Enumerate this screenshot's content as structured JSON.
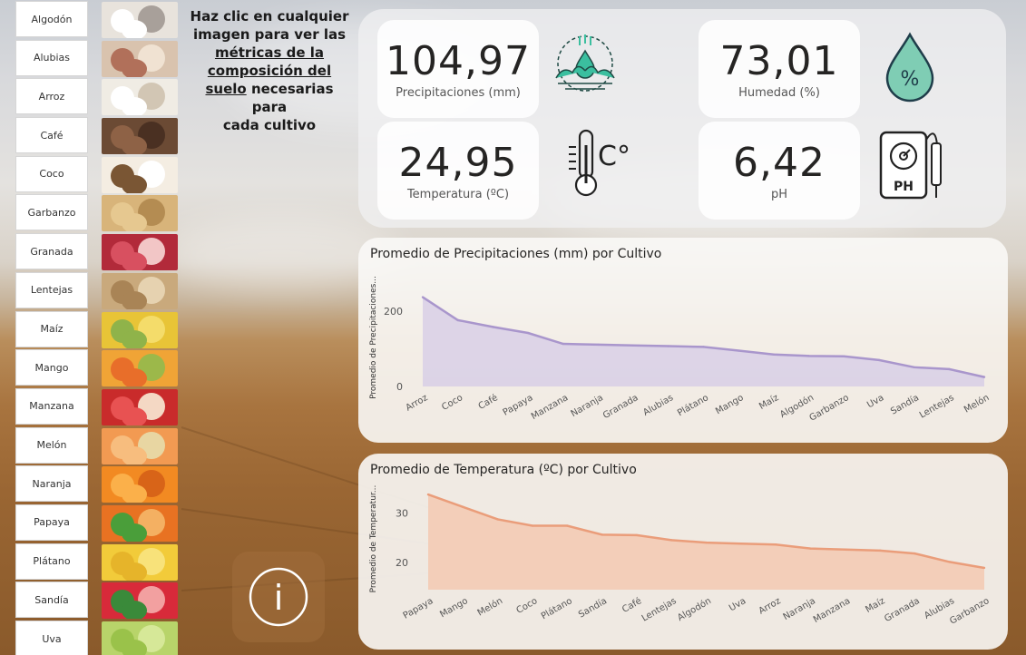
{
  "intro": {
    "line1": "Haz clic en cualquier",
    "line2": "imagen para ver las",
    "line3": "métricas de la",
    "line4": "composición del",
    "line5_u": "suelo",
    "line5_rest": " necesarias para",
    "line6": "cada cultivo"
  },
  "crops": [
    "Algodón",
    "Alubias",
    "Arroz",
    "Café",
    "Coco",
    "Garbanzo",
    "Granada",
    "Lentejas",
    "Maíz",
    "Mango",
    "Manzana",
    "Melón",
    "Naranja",
    "Papaya",
    "Plátano",
    "Sandía",
    "Uva"
  ],
  "kpis": {
    "precip": {
      "value": "104,97",
      "label": "Precipitaciones (mm)"
    },
    "humidity": {
      "value": "73,01",
      "label": "Humedad (%)"
    },
    "temp": {
      "value": "24,95",
      "label": "Temperatura (ºC)"
    },
    "ph": {
      "value": "6,42",
      "label": "pH"
    }
  },
  "icons": {
    "ph_text": "PH",
    "percent": "%",
    "celsius": "C°",
    "info": "i"
  },
  "colors": {
    "precip_fill": "#d8cfe6",
    "precip_line": "#a996cc",
    "temp_fill": "#f3c9b2",
    "temp_line": "#ea9d7a",
    "icon_teal": "#3bbf9f"
  },
  "chart_data": [
    {
      "type": "area",
      "title": "Promedio de Precipitaciones (mm) por Cultivo",
      "ylabel": "Promedio de Precipitaciones...",
      "xlabel": "",
      "categories": [
        "Arroz",
        "Coco",
        "Café",
        "Papaya",
        "Manzana",
        "Naranja",
        "Granada",
        "Alubias",
        "Plátano",
        "Mango",
        "Maíz",
        "Algodón",
        "Garbanzo",
        "Uva",
        "Sandía",
        "Lentejas",
        "Melón"
      ],
      "values": [
        237,
        176,
        158,
        142,
        113,
        111,
        109,
        107,
        105,
        95,
        85,
        81,
        80,
        70,
        51,
        46,
        25
      ],
      "yticks": [
        0,
        200
      ],
      "ylim": [
        0,
        260
      ]
    },
    {
      "type": "area",
      "title": "Promedio de Temperatura (ºC) por Cultivo",
      "ylabel": "Promedio de Temperatur...",
      "xlabel": "",
      "categories": [
        "Papaya",
        "Mango",
        "Melón",
        "Coco",
        "Plátano",
        "Sandía",
        "Café",
        "Lentejas",
        "Algodón",
        "Uva",
        "Arroz",
        "Naranja",
        "Manzana",
        "Maíz",
        "Granada",
        "Alubias",
        "Garbanzo"
      ],
      "values": [
        33.7,
        31.2,
        28.7,
        27.4,
        27.4,
        25.6,
        25.5,
        24.5,
        24.0,
        23.8,
        23.6,
        22.8,
        22.6,
        22.4,
        21.8,
        20.1,
        18.9
      ],
      "yticks": [
        20,
        30
      ],
      "ylim": [
        14.5,
        35
      ]
    }
  ]
}
